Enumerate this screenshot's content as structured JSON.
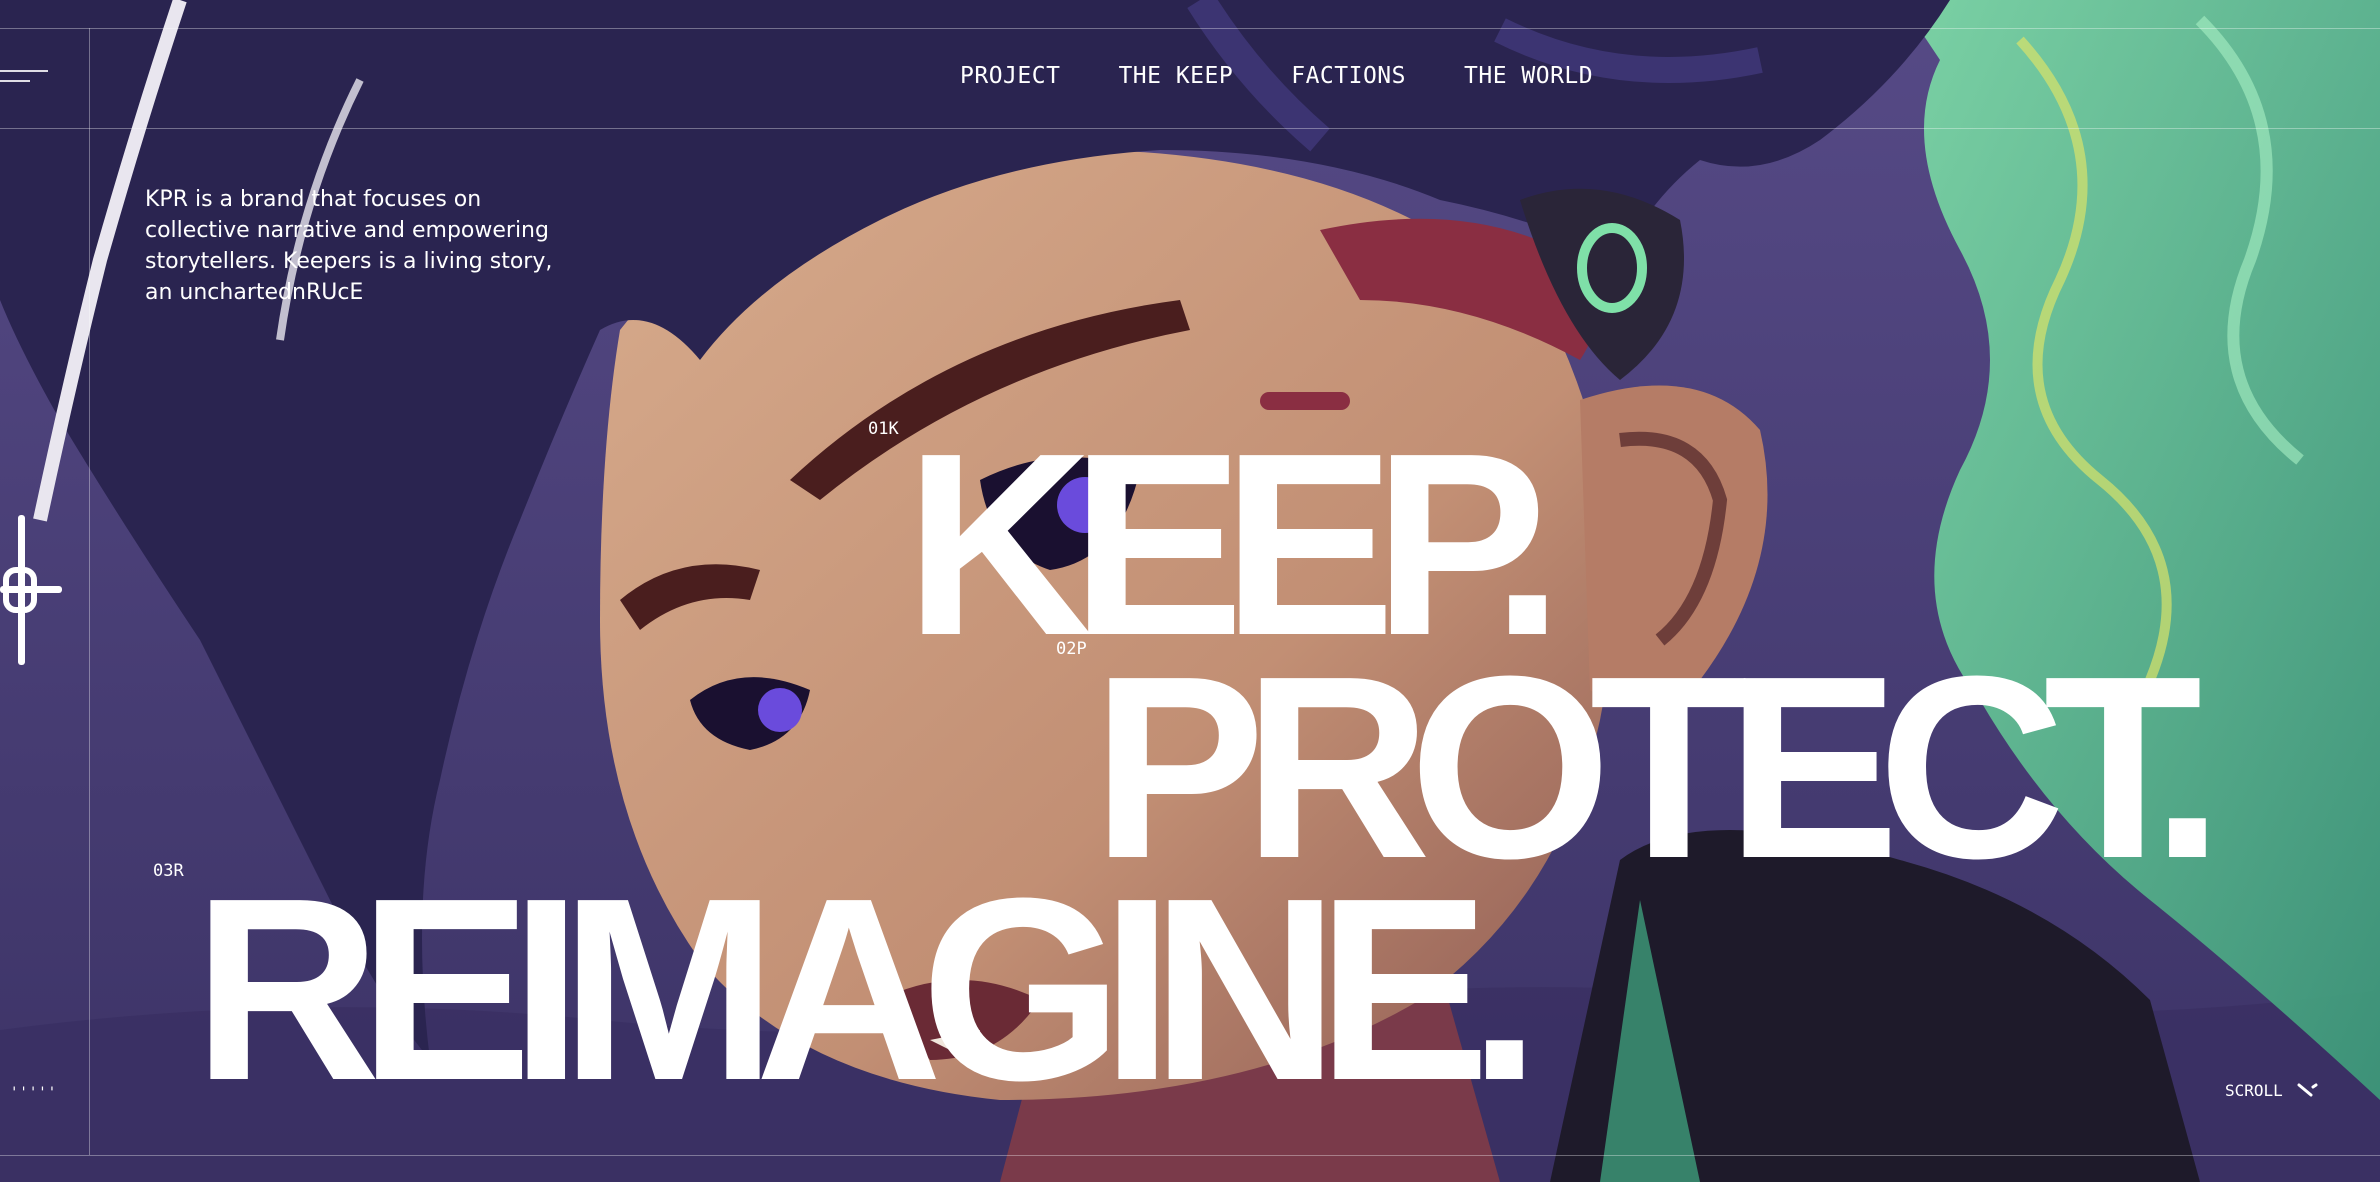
{
  "nav": {
    "items": [
      {
        "label": "PROJECT"
      },
      {
        "label": "THE KEEP"
      },
      {
        "label": "FACTIONS"
      },
      {
        "label": "THE WORLD"
      }
    ]
  },
  "intro": {
    "text": "KPR is a brand that focuses on collective narrative and empowering storytellers. Keepers is a living story, an unchartednRUcE"
  },
  "headline": {
    "line1": {
      "tag": "01K",
      "text": "KEEP."
    },
    "line2": {
      "tag": "02P",
      "text": "PROTECT."
    },
    "line3": {
      "tag": "03R",
      "text": "REIMAGINE."
    }
  },
  "footer": {
    "scroll_label": "SCROLL",
    "tick_marks": "'''''"
  },
  "icons": {
    "menu": "hamburger-icon",
    "crosshair": "crosshair-icon",
    "scroll": "arrow-down-right-icon"
  },
  "colors": {
    "background": "#4a3f74",
    "skin": "#c89a7f",
    "hair": "#2a2450",
    "spirit_green": "#5fc89a",
    "text": "#ffffff"
  }
}
